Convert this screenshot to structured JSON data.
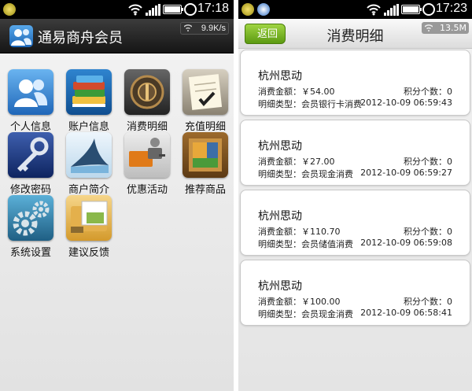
{
  "left": {
    "status": {
      "time": "17:18"
    },
    "app": {
      "title": "通易商舟会员",
      "speed": "9.9K/s"
    },
    "tiles": [
      {
        "label": "个人信息",
        "icon": "users-icon"
      },
      {
        "label": "账户信息",
        "icon": "books-icon"
      },
      {
        "label": "消费明细",
        "icon": "vault-icon"
      },
      {
        "label": "充值明细",
        "icon": "notepad-icon"
      },
      {
        "label": "修改密码",
        "icon": "key-icon"
      },
      {
        "label": "商户简介",
        "icon": "shark-icon"
      },
      {
        "label": "优惠活动",
        "icon": "camera-icon"
      },
      {
        "label": "推荐商品",
        "icon": "picture-frame-icon"
      },
      {
        "label": "系统设置",
        "icon": "gears-icon"
      },
      {
        "label": "建议反馈",
        "icon": "folder-icon"
      }
    ]
  },
  "right": {
    "status": {
      "time": "17:23"
    },
    "nav": {
      "back": "返回",
      "title": "消费明细",
      "memory": "13.5M"
    },
    "records": [
      {
        "merchant": "杭州思动",
        "amount": "消费金额：￥54.00",
        "points": "积分个数：0",
        "type": "明细类型：会员银行卡消费",
        "datetime": "2012-10-09 06:59:43"
      },
      {
        "merchant": "杭州思动",
        "amount": "消费金额：￥27.00",
        "points": "积分个数：0",
        "type": "明细类型：会员现金消费",
        "datetime": "2012-10-09 06:59:27"
      },
      {
        "merchant": "杭州思动",
        "amount": "消费金额：￥110.70",
        "points": "积分个数：0",
        "type": "明细类型：会员储值消费",
        "datetime": "2012-10-09 06:59:08"
      },
      {
        "merchant": "杭州思动",
        "amount": "消费金额：￥100.00",
        "points": "积分个数：0",
        "type": "明细类型：会员现金消费",
        "datetime": "2012-10-09 06:58:41"
      }
    ]
  },
  "colors": {
    "back_button": "#6aa51a",
    "status_bar": "#000000",
    "app_bar": "#202020"
  }
}
